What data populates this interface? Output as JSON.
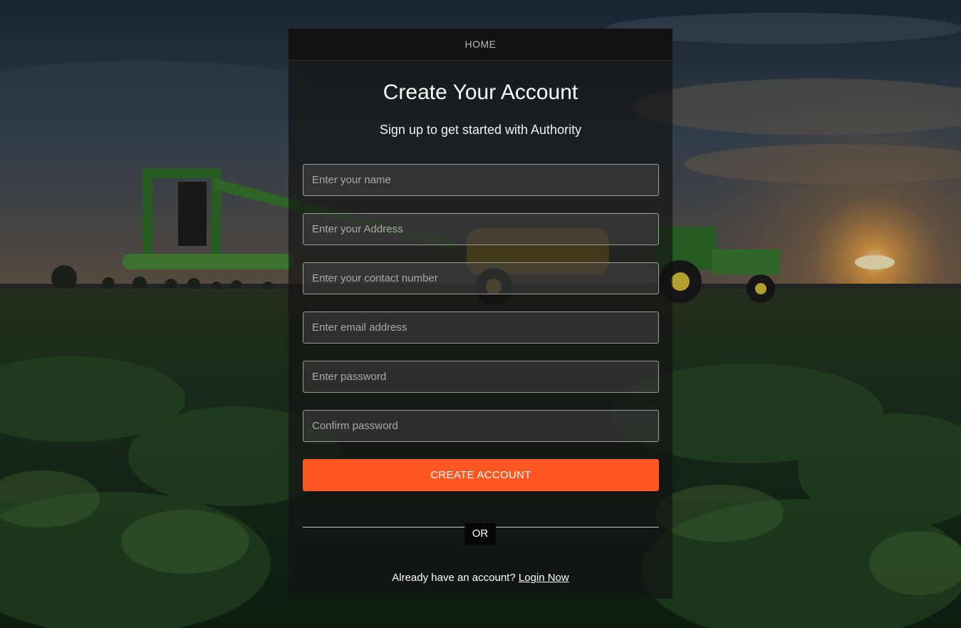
{
  "nav": {
    "home_label": "HOME"
  },
  "header": {
    "title": "Create Your Account",
    "subtitle": "Sign up to get started with Authority"
  },
  "form": {
    "name_placeholder": "Enter your name",
    "address_placeholder": "Enter your Address",
    "contact_placeholder": "Enter your contact number",
    "email_placeholder": "Enter email address",
    "password_placeholder": "Enter password",
    "confirm_placeholder": "Confirm password",
    "submit_label": "CREATE ACCOUNT"
  },
  "divider": {
    "label": "OR"
  },
  "footer": {
    "prompt": "Already have an account?",
    "login_label": "Login Now"
  },
  "colors": {
    "accent": "#ff5722",
    "card_bg": "rgba(18,18,18,0.68)"
  },
  "background": {
    "icon": "farm-field-with-sprayer-tractor-at-sunset"
  }
}
